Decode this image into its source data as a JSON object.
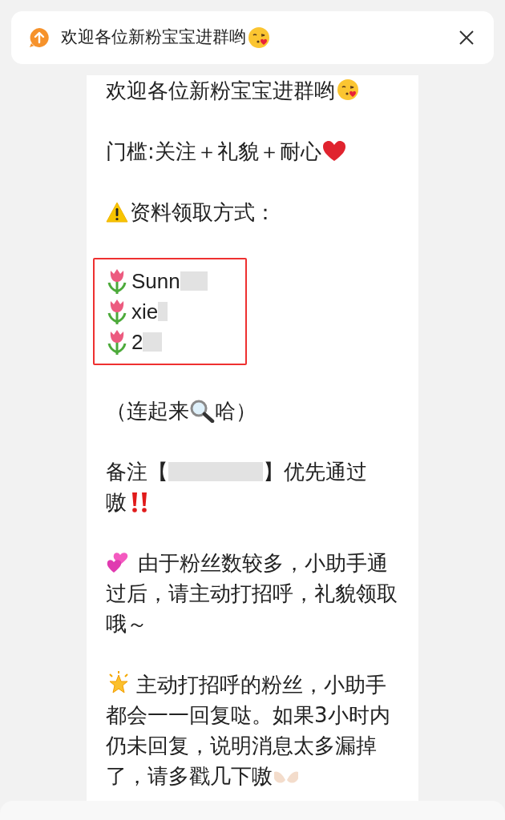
{
  "banner": {
    "text": "欢迎各位新粉宝宝进群哟"
  },
  "message": {
    "paragraphs": [
      {
        "kind": "line",
        "text": "欢迎各位新粉宝宝进群哟"
      },
      {
        "kind": "line",
        "text": "门槛:关注＋礼貌＋耐心"
      },
      {
        "kind": "line",
        "text": "资料领取方式："
      },
      {
        "kind": "boxed_list",
        "items": [
          "Sunn",
          "xie",
          "2"
        ]
      },
      {
        "kind": "split",
        "before": "（连起来",
        "after": "哈）"
      },
      {
        "kind": "redacted",
        "before": "备注【",
        "after": "】优先通过",
        "next_line": "嗷"
      },
      {
        "kind": "line",
        "text": "由于粉丝数较多，小助手通过后，请主动打招呼，礼貌领取哦～"
      },
      {
        "kind": "line",
        "text": "主动打招呼的粉丝，小助手都会一一回复哒。如果3小时内仍未回复，说明消息太多漏掉了，请多戳几下嗷"
      }
    ]
  }
}
